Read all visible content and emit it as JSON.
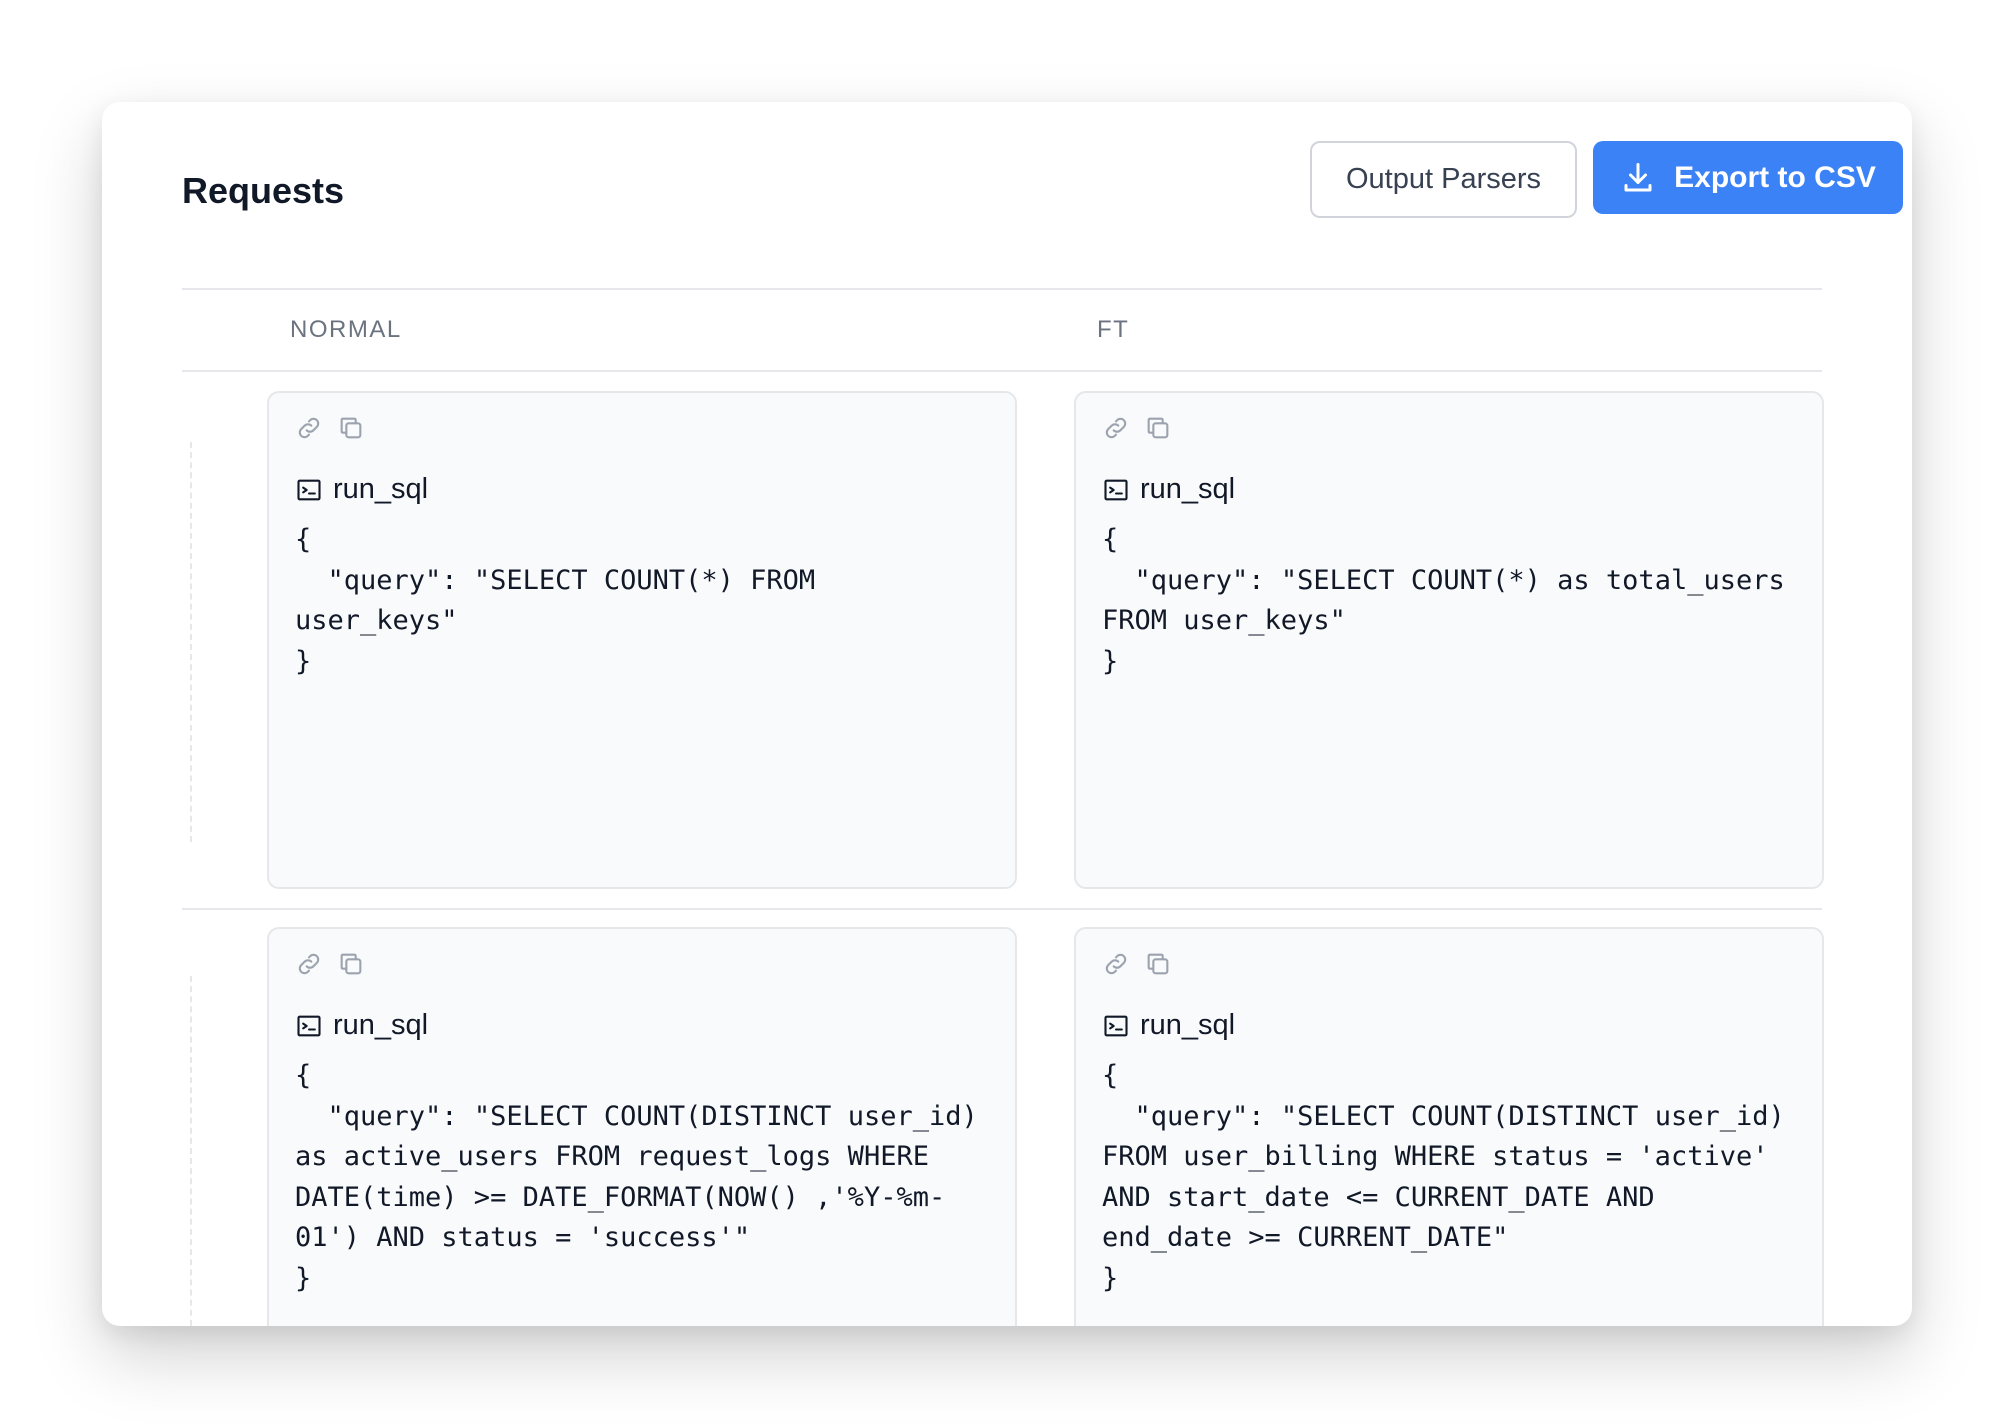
{
  "page": {
    "title": "Requests"
  },
  "toolbar": {
    "output_parsers_label": "Output Parsers",
    "export_label": "Export to CSV"
  },
  "columns": [
    "NORMAL",
    "FT"
  ],
  "rows": [
    {
      "normal": {
        "tool": "run_sql",
        "code": "{\n  \"query\": \"SELECT COUNT(*) FROM user_keys\"\n}"
      },
      "ft": {
        "tool": "run_sql",
        "code": "{\n  \"query\": \"SELECT COUNT(*) as total_users FROM user_keys\"\n}"
      }
    },
    {
      "normal": {
        "tool": "run_sql",
        "code": "{\n  \"query\": \"SELECT COUNT(DISTINCT user_id) as active_users FROM request_logs WHERE DATE(time) >= DATE_FORMAT(NOW() ,'%Y-%m-01') AND status = 'success'\"\n}"
      },
      "ft": {
        "tool": "run_sql",
        "code": "{\n  \"query\": \"SELECT COUNT(DISTINCT user_id) FROM user_billing WHERE status = 'active' AND start_date <= CURRENT_DATE AND end_date >= CURRENT_DATE\"\n}"
      }
    }
  ],
  "colors": {
    "accent": "#3b82f6",
    "border": "#e5e7eb",
    "cell_bg": "#f9fafb"
  }
}
